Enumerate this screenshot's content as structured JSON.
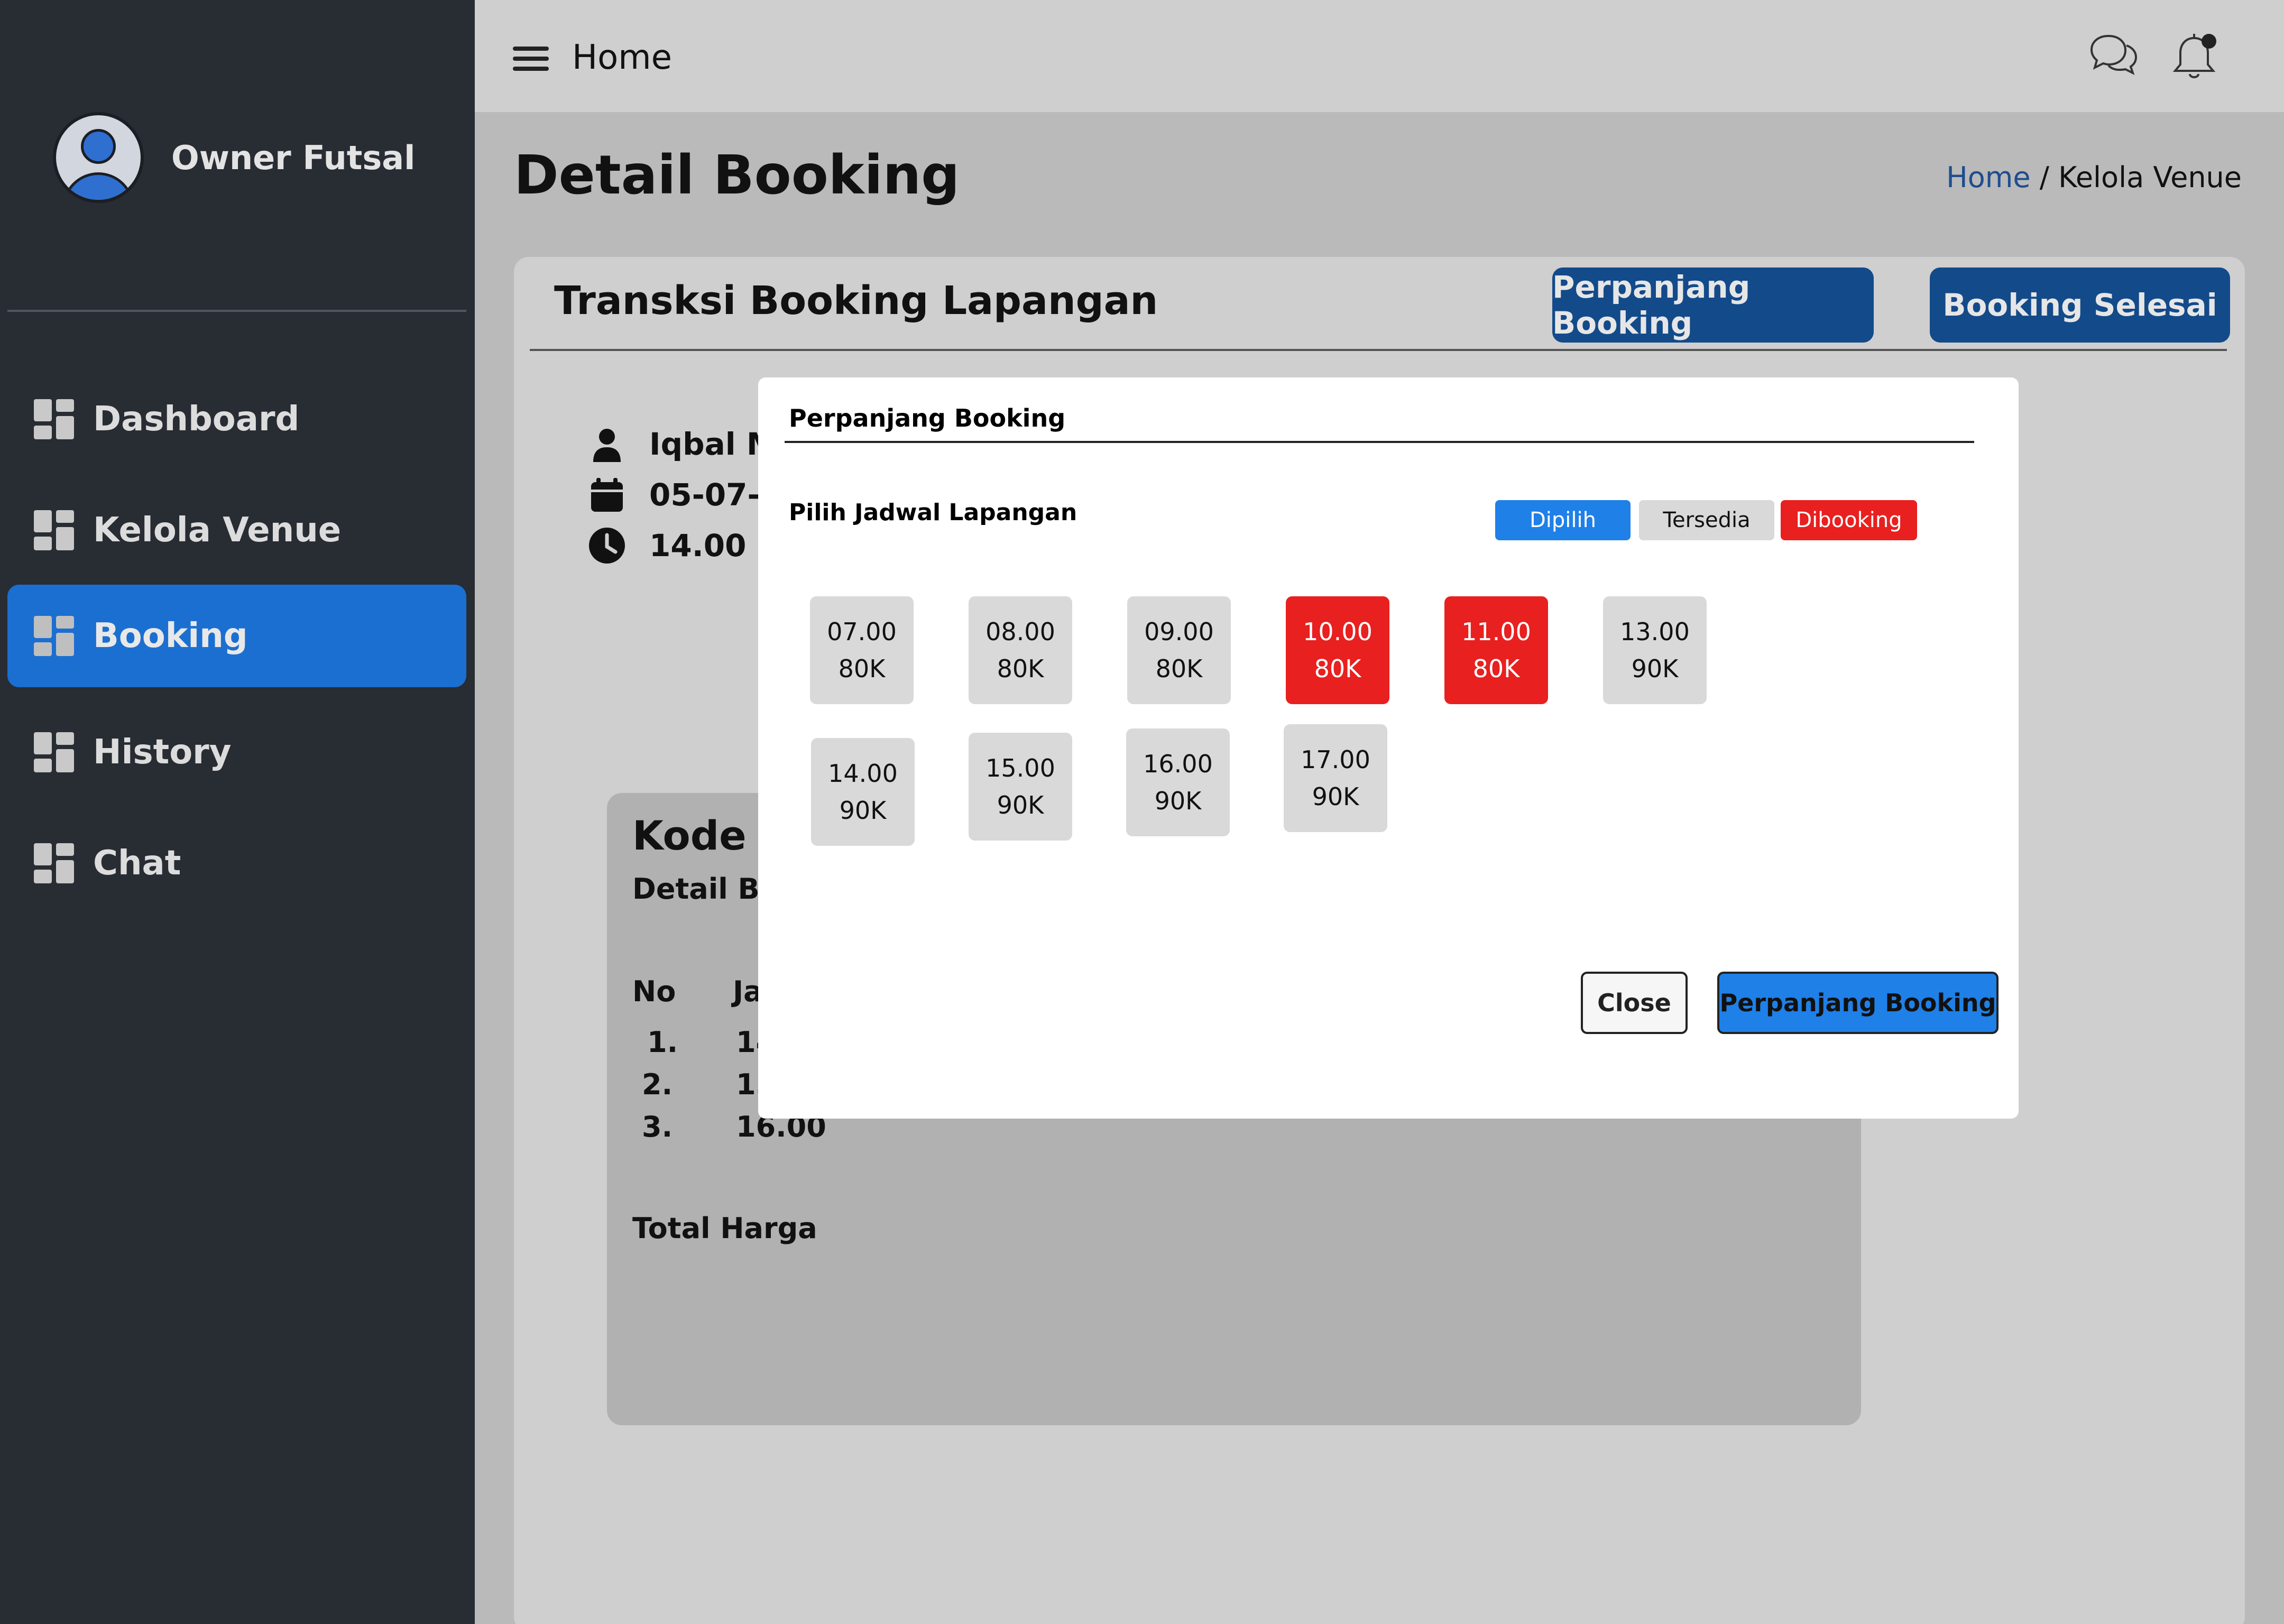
{
  "sidebar": {
    "owner_name": "Owner Futsal",
    "items": [
      {
        "label": "Dashboard",
        "active": false
      },
      {
        "label": "Kelola Venue",
        "active": false
      },
      {
        "label": "Booking",
        "active": true
      },
      {
        "label": "History",
        "active": false
      },
      {
        "label": "Chat",
        "active": false
      }
    ]
  },
  "topbar": {
    "title": "Home",
    "icons": [
      "menu-icon",
      "chat-icon",
      "bell-icon"
    ]
  },
  "page": {
    "title": "Detail Booking",
    "breadcrumb": {
      "home": "Home",
      "separator": " / ",
      "current": "Kelola Venue"
    }
  },
  "card": {
    "title": "Transksi Booking Lapangan",
    "extend_button": "Perpanjang Booking",
    "finish_button": "Booking Selesai",
    "info": {
      "name": "Iqbal M",
      "date": "05-07-",
      "time": "14.00 - 1"
    },
    "inner": {
      "code_label": "Kode Boo",
      "detail_label": "Detail Booki",
      "table_headers": [
        "No",
        "Jam"
      ],
      "rows": [
        {
          "no": "1.",
          "jam": "14.00"
        },
        {
          "no": "2.",
          "jam": "15.00"
        },
        {
          "no": "3.",
          "jam": "16.00"
        }
      ],
      "total_label": "Total Harga"
    }
  },
  "modal": {
    "title": "Perpanjang  Booking",
    "subtitle": "Pilih Jadwal Lapangan",
    "legend": [
      {
        "label": "Dipilih",
        "color": "#1f80e8"
      },
      {
        "label": "Tersedia",
        "color": "#d9d9d9"
      },
      {
        "label": "Dibooking",
        "color": "#e8201f"
      }
    ],
    "slots": [
      {
        "time": "07.00",
        "price": "80K",
        "status": "tersedia"
      },
      {
        "time": "08.00",
        "price": "80K",
        "status": "tersedia"
      },
      {
        "time": "09.00",
        "price": "80K",
        "status": "tersedia"
      },
      {
        "time": "10.00",
        "price": "80K",
        "status": "dibooking"
      },
      {
        "time": "11.00",
        "price": "80K",
        "status": "dibooking"
      },
      {
        "time": "13.00",
        "price": "90K",
        "status": "tersedia"
      },
      {
        "time": "14.00",
        "price": "90K",
        "status": "tersedia"
      },
      {
        "time": "15.00",
        "price": "90K",
        "status": "tersedia"
      },
      {
        "time": "16.00",
        "price": "90K",
        "status": "tersedia"
      },
      {
        "time": "17.00",
        "price": "90K",
        "status": "tersedia"
      }
    ],
    "close_button": "Close",
    "submit_button": "Perpanjang Booking"
  }
}
